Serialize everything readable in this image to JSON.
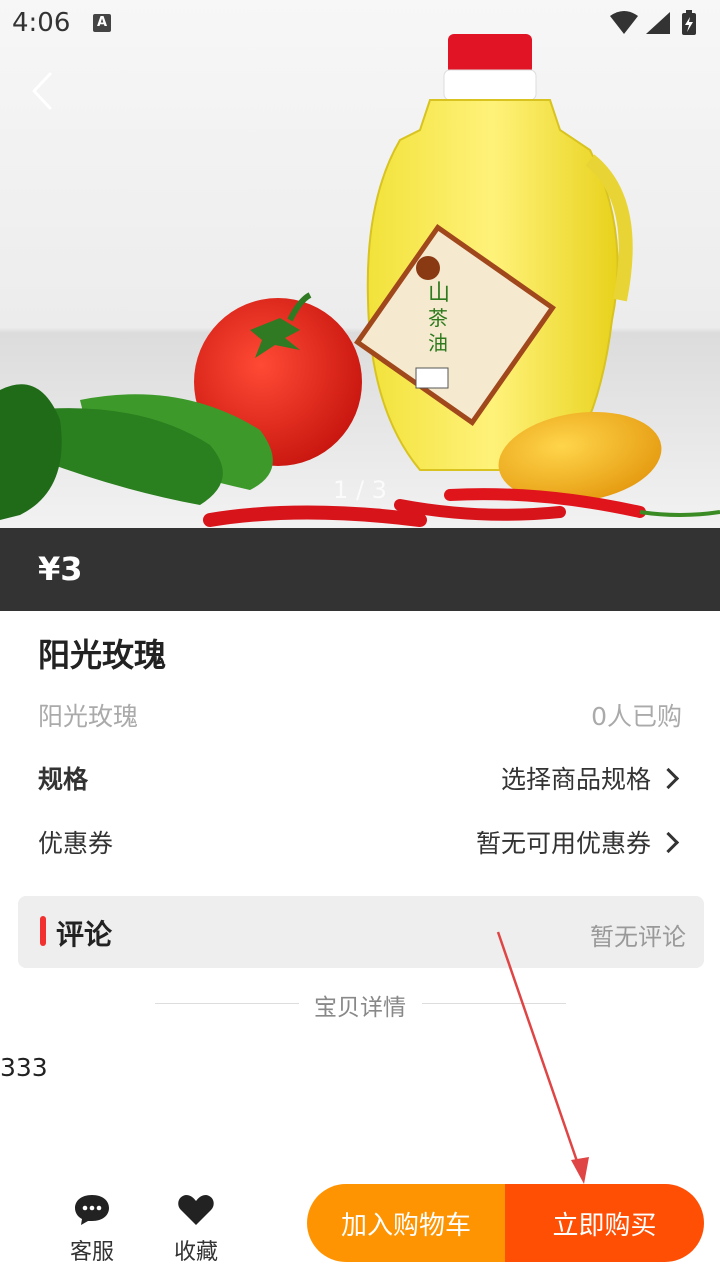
{
  "status_bar": {
    "time": "4:06",
    "notification_letter": "A"
  },
  "gallery": {
    "pager": "1 / 3",
    "label_brand": "山茶油"
  },
  "product": {
    "price": "¥3",
    "title": "阳光玫瑰",
    "subtitle": "阳光玫瑰",
    "buyers": "0人已购"
  },
  "spec": {
    "label": "规格",
    "value": "选择商品规格"
  },
  "coupon": {
    "label": "优惠券",
    "value": "暂无可用优惠券"
  },
  "comments": {
    "title": "评论",
    "empty_text": "暂无评论"
  },
  "detail": {
    "section_title": "宝贝详情",
    "content": "333"
  },
  "bottom_bar": {
    "service_label": "客服",
    "favorite_label": "收藏",
    "add_to_cart": "加入购物车",
    "buy_now": "立即购买"
  },
  "colors": {
    "price_bar": "#333333",
    "cart_button": "#ff9402",
    "buy_button": "#ff4f05",
    "accent": "#f23030",
    "annotation_arrow": "#e04545"
  }
}
